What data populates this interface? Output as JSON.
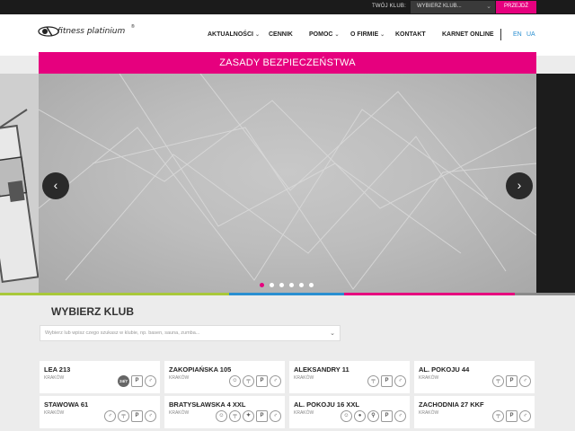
{
  "topbar": {
    "club_label": "TWÓJ KLUB:",
    "club_select_value": "WYBIERZ KLUB...",
    "go_button": "PRZEJDŹ"
  },
  "logo": {
    "text": "fitness platinium",
    "trademark": "®"
  },
  "nav": {
    "items": [
      {
        "label": "AKTUALNOŚCI",
        "has_dropdown": true
      },
      {
        "label": "CENNIK",
        "has_dropdown": false
      },
      {
        "label": "POMOC",
        "has_dropdown": true
      },
      {
        "label": "O FIRMIE",
        "has_dropdown": true
      },
      {
        "label": "KONTAKT",
        "has_dropdown": false
      },
      {
        "label": "KARNET ONLINE",
        "has_dropdown": false
      }
    ],
    "languages": [
      "EN",
      "UA"
    ]
  },
  "banner": {
    "text": "ZASADY BEZPIECZEŃSTWA"
  },
  "slider": {
    "prev": "‹",
    "next": "›",
    "slide_count": 6,
    "active_index": 0
  },
  "stripe_colors": [
    "#a8c83a",
    "#2a8fd1",
    "#e6007e",
    "#8a8a8a"
  ],
  "clubs_section": {
    "title": "WYBIERZ KLUB",
    "search_placeholder": "Wybierz lub wpisz czego szukasz w klubie, np. basen, sauna, zumba...",
    "clubs": [
      {
        "name": "LEA 213",
        "city": "KRAKÓW",
        "icons": [
          "24/7",
          "P",
          "fitness-icon"
        ]
      },
      {
        "name": "ZAKOPIAŃSKA 105",
        "city": "KRAKÓW",
        "icons": [
          "kids-icon",
          "dumbbell-icon",
          "P",
          "fitness-icon"
        ]
      },
      {
        "name": "ALEKSANDRY 11",
        "city": "KRAKÓW",
        "icons": [
          "dumbbell-icon",
          "P",
          "fitness-icon"
        ]
      },
      {
        "name": "AL. POKOJU 44",
        "city": "KRAKÓW",
        "icons": [
          "dumbbell-icon",
          "P",
          "fitness-icon"
        ]
      },
      {
        "name": "STAWOWA 61",
        "city": "KRAKÓW",
        "icons": [
          "fitness-icon",
          "dumbbell-icon",
          "P",
          "fitness-icon"
        ]
      },
      {
        "name": "BRATYSŁAWSKA 4 XXL",
        "city": "KRAKÓW",
        "icons": [
          "kids-icon",
          "dumbbell-icon",
          "martial-arts-icon",
          "P",
          "fitness-icon"
        ]
      },
      {
        "name": "AL. POKOJU 16 XXL",
        "city": "KRAKÓW",
        "icons": [
          "kids-icon",
          "ball-icon",
          "squash-icon",
          "P",
          "fitness-icon"
        ]
      },
      {
        "name": "ZACHODNIA 27 KKF",
        "city": "KRAKÓW",
        "icons": [
          "dumbbell-icon",
          "P",
          "fitness-icon"
        ]
      }
    ]
  }
}
